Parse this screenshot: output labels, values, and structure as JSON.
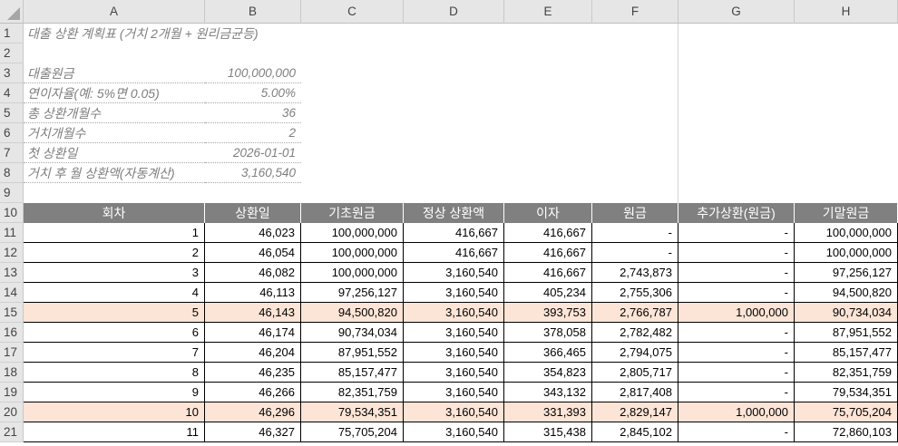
{
  "columns": [
    "A",
    "B",
    "C",
    "D",
    "E",
    "F",
    "G",
    "H"
  ],
  "rows": [
    "1",
    "2",
    "3",
    "4",
    "5",
    "6",
    "7",
    "8",
    "9",
    "10",
    "11",
    "12",
    "13",
    "14",
    "15",
    "16",
    "17",
    "18",
    "19",
    "20",
    "21"
  ],
  "title": "대출 상환 계획표 (거치 2개월 + 원리금균등)",
  "params": [
    {
      "label": "대출원금",
      "value": "100,000,000"
    },
    {
      "label": "연이자율(예: 5%면 0.05)",
      "value": "5.00%"
    },
    {
      "label": "총 상환개월수",
      "value": "36"
    },
    {
      "label": "거치개월수",
      "value": "2"
    },
    {
      "label": "첫 상환일",
      "value": "2026-01-01"
    },
    {
      "label": "거치 후 월 상환액(자동계산)",
      "value": "3,160,540"
    }
  ],
  "table_headers": [
    "회차",
    "상환일",
    "기초원금",
    "정상 상환액",
    "이자",
    "원금",
    "추가상환(원금)",
    "기말원금"
  ],
  "table_rows": [
    {
      "cells": [
        "1",
        "46,023",
        "100,000,000",
        "416,667",
        "416,667",
        "-",
        "-",
        "100,000,000"
      ],
      "highlight": false
    },
    {
      "cells": [
        "2",
        "46,054",
        "100,000,000",
        "416,667",
        "416,667",
        "-",
        "-",
        "100,000,000"
      ],
      "highlight": false
    },
    {
      "cells": [
        "3",
        "46,082",
        "100,000,000",
        "3,160,540",
        "416,667",
        "2,743,873",
        "-",
        "97,256,127"
      ],
      "highlight": false
    },
    {
      "cells": [
        "4",
        "46,113",
        "97,256,127",
        "3,160,540",
        "405,234",
        "2,755,306",
        "-",
        "94,500,820"
      ],
      "highlight": false
    },
    {
      "cells": [
        "5",
        "46,143",
        "94,500,820",
        "3,160,540",
        "393,753",
        "2,766,787",
        "1,000,000",
        "90,734,034"
      ],
      "highlight": true
    },
    {
      "cells": [
        "6",
        "46,174",
        "90,734,034",
        "3,160,540",
        "378,058",
        "2,782,482",
        "-",
        "87,951,552"
      ],
      "highlight": false
    },
    {
      "cells": [
        "7",
        "46,204",
        "87,951,552",
        "3,160,540",
        "366,465",
        "2,794,075",
        "-",
        "85,157,477"
      ],
      "highlight": false
    },
    {
      "cells": [
        "8",
        "46,235",
        "85,157,477",
        "3,160,540",
        "354,823",
        "2,805,717",
        "-",
        "82,351,759"
      ],
      "highlight": false
    },
    {
      "cells": [
        "9",
        "46,266",
        "82,351,759",
        "3,160,540",
        "343,132",
        "2,817,408",
        "-",
        "79,534,351"
      ],
      "highlight": false
    },
    {
      "cells": [
        "10",
        "46,296",
        "79,534,351",
        "3,160,540",
        "331,393",
        "2,829,147",
        "1,000,000",
        "75,705,204"
      ],
      "highlight": true
    },
    {
      "cells": [
        "11",
        "46,327",
        "75,705,204",
        "3,160,540",
        "315,438",
        "2,845,102",
        "-",
        "72,860,103"
      ],
      "highlight": false
    }
  ],
  "colors": {
    "header_bg": "#808080",
    "highlight_bg": "#fce4d6",
    "label_text": "#7f7f7f",
    "gridline": "#d4d4d4"
  }
}
